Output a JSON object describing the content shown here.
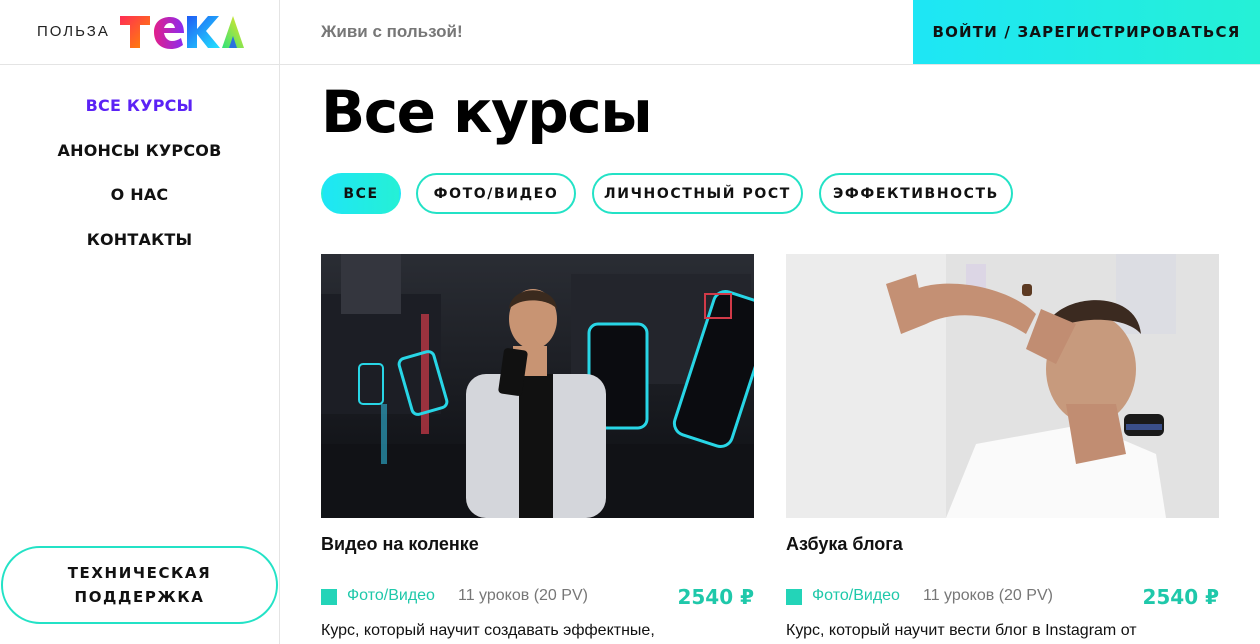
{
  "header": {
    "logo_text": "ПОЛЬЗА",
    "logo_mark": "ТЕКА",
    "tagline": "Живи с пользой!",
    "login_label": "ВОЙТИ / ЗАРЕГИСТРИРОВАТЬСЯ"
  },
  "sidebar": {
    "items": [
      {
        "label": "ВСЕ КУРСЫ",
        "active": true
      },
      {
        "label": "АНОНСЫ КУРСОВ",
        "active": false
      },
      {
        "label": "О НАС",
        "active": false
      },
      {
        "label": "КОНТАКТЫ",
        "active": false
      }
    ],
    "support_label": "ТЕХНИЧЕСКАЯ\nПОДДЕРЖКА"
  },
  "main": {
    "title": "Все курсы",
    "filters": [
      {
        "label": "ВСЕ",
        "active": true
      },
      {
        "label": "ФОТО/ВИДЕО",
        "active": false
      },
      {
        "label": "ЛИЧНОСТНЫЙ РОСТ",
        "active": false
      },
      {
        "label": "ЭФФЕКТИВНОСТЬ",
        "active": false
      }
    ],
    "courses": [
      {
        "title": "Видео на коленке",
        "category": "Фото/Видео",
        "lessons": "11 уроков (20 PV)",
        "price": "2540 ₽",
        "description": "Курс, который научит создавать эффектные,"
      },
      {
        "title": "Азбука блога",
        "category": "Фото/Видео",
        "lessons": "11 уроков (20 PV)",
        "price": "2540 ₽",
        "description": "Курс, который научит вести блог в Instagram от"
      }
    ]
  },
  "colors": {
    "accent_cyan": "#1ee6f5",
    "accent_teal": "#23e2c6",
    "active_nav": "#5b22f5",
    "price": "#1fc8aa"
  },
  "icons": [
    "logo-mark-icon",
    "category-square-icon"
  ]
}
